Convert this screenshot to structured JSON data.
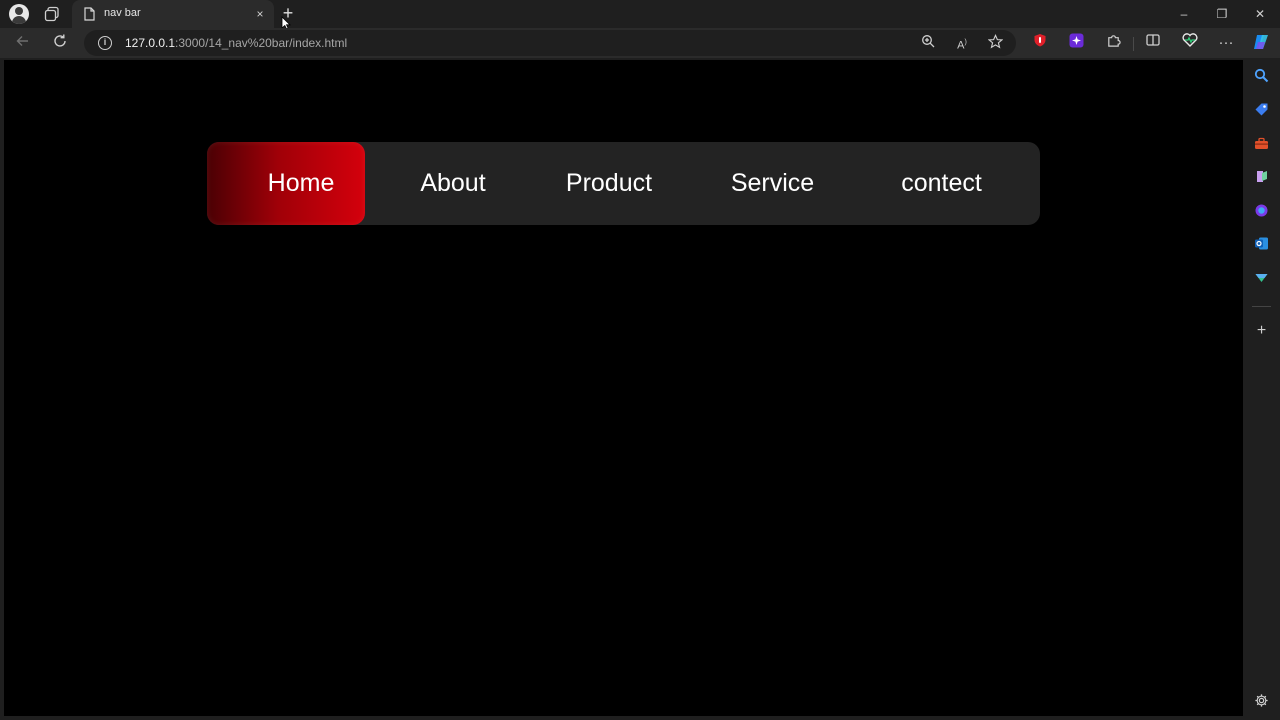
{
  "browser": {
    "tab": {
      "title": "nav bar",
      "close_glyph": "×"
    },
    "new_tab_glyph": "+",
    "window_controls": {
      "minimize": "–",
      "restore": "❐",
      "close": "✕"
    },
    "address": {
      "host": "127.0.0.1",
      "path": ":3000/14_nav%20bar/index.html"
    },
    "info_glyph": "i",
    "toolbar_icons": [
      "zoom-icon",
      "read-aloud-icon",
      "favorite-star-icon"
    ],
    "extension_icons": [
      "adblock-extension-icon",
      "ai-extension-icon",
      "extensions-puzzle-icon",
      "split-screen-icon",
      "browser-essentials-icon",
      "more-menu-icon",
      "copilot-icon"
    ],
    "sidebar_icons": [
      "search-icon",
      "shopping-tag-icon",
      "tools-icon",
      "games-icon",
      "office-icon",
      "outlook-icon",
      "drop-icon",
      "add-icon",
      "settings-gear-icon"
    ]
  },
  "nav": {
    "items": [
      {
        "label": "Home",
        "active": true
      },
      {
        "label": "About",
        "active": false
      },
      {
        "label": "Product",
        "active": false
      },
      {
        "label": "Service",
        "active": false
      },
      {
        "label": "contect",
        "active": false
      }
    ],
    "active_gradient": [
      "#4a0004",
      "#d4000c"
    ],
    "bar_color": "#232323"
  }
}
